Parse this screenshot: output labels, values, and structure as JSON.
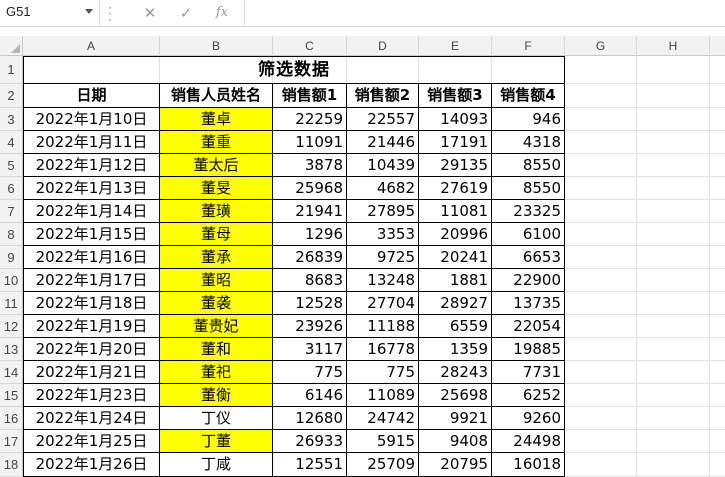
{
  "formula_bar": {
    "name_box": "G51",
    "cancel_icon": "close-icon",
    "enter_icon": "check-icon",
    "fx_label": "fx"
  },
  "columns": [
    "A",
    "B",
    "C",
    "D",
    "E",
    "F",
    "G",
    "H"
  ],
  "sheet": {
    "title": "筛选数据",
    "headers": [
      "日期",
      "销售人员姓名",
      "销售额1",
      "销售额2",
      "销售额3",
      "销售额4"
    ],
    "rows": [
      {
        "date": "2022年1月10日",
        "name": "董卓",
        "s1": "22259",
        "s2": "22557",
        "s3": "14093",
        "s4": "946",
        "highlight": true
      },
      {
        "date": "2022年1月11日",
        "name": "董重",
        "s1": "11091",
        "s2": "21446",
        "s3": "17191",
        "s4": "4318",
        "highlight": true
      },
      {
        "date": "2022年1月12日",
        "name": "董太后",
        "s1": "3878",
        "s2": "10439",
        "s3": "29135",
        "s4": "8550",
        "highlight": true
      },
      {
        "date": "2022年1月13日",
        "name": "董旻",
        "s1": "25968",
        "s2": "4682",
        "s3": "27619",
        "s4": "8550",
        "highlight": true
      },
      {
        "date": "2022年1月14日",
        "name": "董璜",
        "s1": "21941",
        "s2": "27895",
        "s3": "11081",
        "s4": "23325",
        "highlight": true
      },
      {
        "date": "2022年1月15日",
        "name": "董母",
        "s1": "1296",
        "s2": "3353",
        "s3": "20996",
        "s4": "6100",
        "highlight": true
      },
      {
        "date": "2022年1月16日",
        "name": "董承",
        "s1": "26839",
        "s2": "9725",
        "s3": "20241",
        "s4": "6653",
        "highlight": true
      },
      {
        "date": "2022年1月17日",
        "name": "董昭",
        "s1": "8683",
        "s2": "13248",
        "s3": "1881",
        "s4": "22900",
        "highlight": true
      },
      {
        "date": "2022年1月18日",
        "name": "董袭",
        "s1": "12528",
        "s2": "27704",
        "s3": "28927",
        "s4": "13735",
        "highlight": true
      },
      {
        "date": "2022年1月19日",
        "name": "董贵妃",
        "s1": "23926",
        "s2": "11188",
        "s3": "6559",
        "s4": "22054",
        "highlight": true
      },
      {
        "date": "2022年1月20日",
        "name": "董和",
        "s1": "3117",
        "s2": "16778",
        "s3": "1359",
        "s4": "19885",
        "highlight": true
      },
      {
        "date": "2022年1月21日",
        "name": "董祀",
        "s1": "775",
        "s2": "775",
        "s3": "28243",
        "s4": "7731",
        "highlight": true
      },
      {
        "date": "2022年1月23日",
        "name": "董衡",
        "s1": "6146",
        "s2": "11089",
        "s3": "25698",
        "s4": "6252",
        "highlight": true
      },
      {
        "date": "2022年1月24日",
        "name": "丁仪",
        "s1": "12680",
        "s2": "24742",
        "s3": "9921",
        "s4": "9260",
        "highlight": false
      },
      {
        "date": "2022年1月25日",
        "name": "丁董",
        "s1": "26933",
        "s2": "5915",
        "s3": "9408",
        "s4": "24498",
        "highlight": true
      },
      {
        "date": "2022年1月26日",
        "name": "丁咸",
        "s1": "12551",
        "s2": "25709",
        "s3": "20795",
        "s4": "16018",
        "highlight": false
      }
    ]
  },
  "colors": {
    "highlight": "#ffff00",
    "header_bg": "#f2f2f2"
  }
}
